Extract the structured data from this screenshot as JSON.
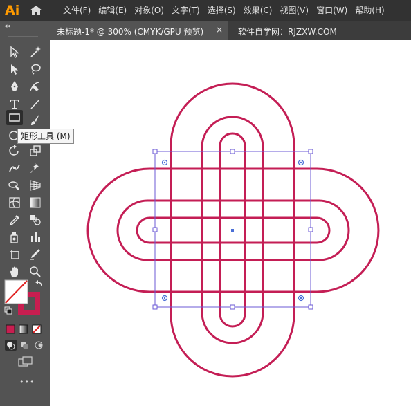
{
  "app": {
    "logo": "Ai"
  },
  "menu": {
    "items": [
      "文件(F)",
      "编辑(E)",
      "对象(O)",
      "文字(T)",
      "选择(S)",
      "效果(C)",
      "视图(V)",
      "窗口(W)",
      "帮助(H)"
    ]
  },
  "tabs": {
    "active": {
      "label": "未标题-1* @ 300% (CMYK/GPU 预览)",
      "close": "×"
    },
    "inactive": {
      "label": "软件自学网：RJZXW.COM"
    }
  },
  "panel": {
    "collapse": "◂◂"
  },
  "tooltip": {
    "text": "矩形工具 (M)"
  },
  "tools": [
    {
      "name": "selection-tool-icon"
    },
    {
      "name": "magic-wand-tool-icon"
    },
    {
      "name": "direct-selection-tool-icon"
    },
    {
      "name": "lasso-tool-icon"
    },
    {
      "name": "pen-tool-icon"
    },
    {
      "name": "curvature-tool-icon"
    },
    {
      "name": "type-tool-icon"
    },
    {
      "name": "line-segment-tool-icon"
    },
    {
      "name": "rectangle-tool-icon"
    },
    {
      "name": "paintbrush-tool-icon"
    },
    {
      "name": "rotate-tool-icon"
    },
    {
      "name": "scale-tool-icon"
    },
    {
      "name": "puppet-warp-tool-icon"
    },
    {
      "name": "pin-tool-icon"
    },
    {
      "name": "shape-builder-tool-icon"
    },
    {
      "name": "perspective-grid-tool-icon"
    },
    {
      "name": "mesh-tool-icon"
    },
    {
      "name": "gradient-tool-icon"
    },
    {
      "name": "eyedropper-tool-icon"
    },
    {
      "name": "blend-tool-icon"
    },
    {
      "name": "symbol-sprayer-tool-icon"
    },
    {
      "name": "column-graph-tool-icon"
    },
    {
      "name": "artboard-tool-icon"
    },
    {
      "name": "slice-tool-icon"
    },
    {
      "name": "hand-tool-icon"
    },
    {
      "name": "zoom-tool-icon"
    }
  ],
  "colors": {
    "fill": "#ffffff",
    "stroke": "#c81e50",
    "artwork_stroke": "#c41e55",
    "selection": "#6b5ad6",
    "ui_dark": "#323232",
    "ui_panel": "#535353"
  },
  "more_tools": "•••"
}
